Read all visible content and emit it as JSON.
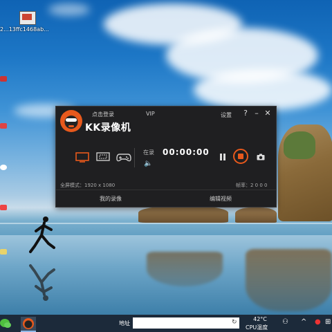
{
  "desktop": {
    "icons": [
      {
        "label": "2...13ffc1468ab..."
      }
    ]
  },
  "recorder": {
    "app_name": "KK录像机",
    "login_label": "点击登录",
    "vip_label": "VIP",
    "settings_label": "设置",
    "help_label": "?",
    "minimize_label": "–",
    "close_label": "✕",
    "record_label": "在录",
    "timer": "00:00:00",
    "fullscreen_mode": "全屏模式：1920 x 1080",
    "fps": "帧率：2 0 0 0",
    "my_videos": "我的录像",
    "edit_video": "编辑视频",
    "active_mode": "screen",
    "accent_color": "#e8591c"
  },
  "taskbar": {
    "address_label": "地址",
    "address_value": "",
    "temperature": "42°C",
    "cpu_label": "CPU温度"
  }
}
